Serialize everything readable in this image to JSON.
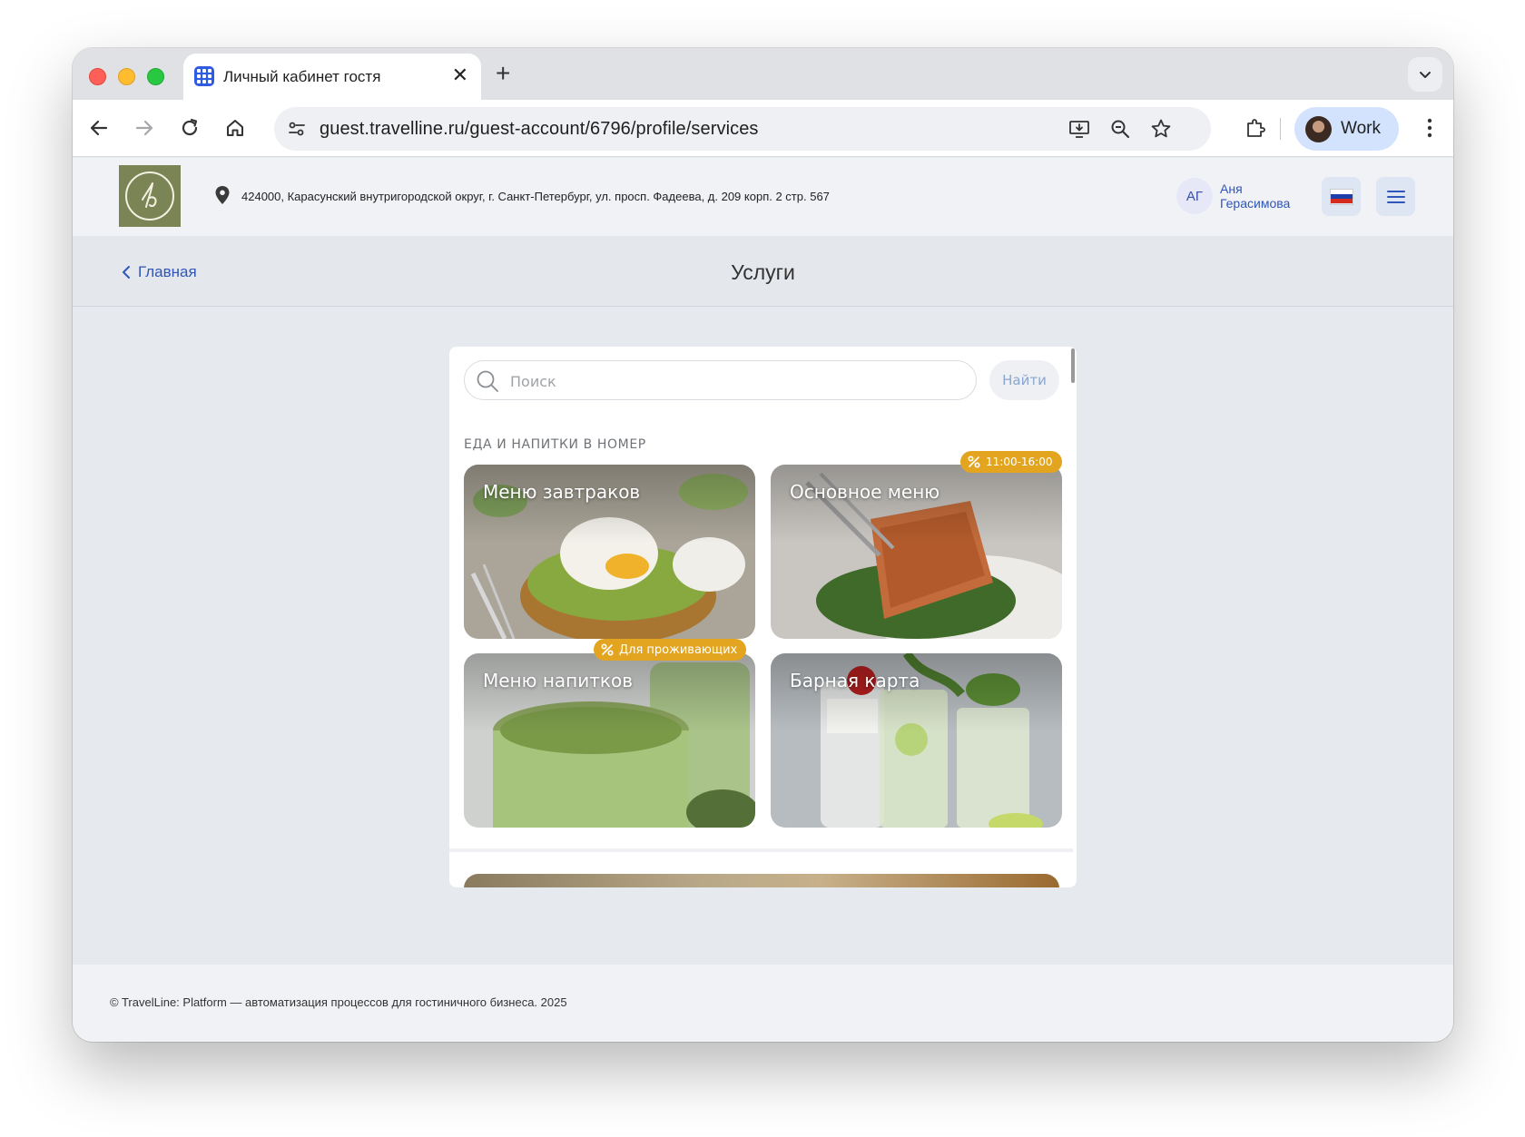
{
  "browser": {
    "tab_title": "Личный кабинет гостя",
    "tab_close": "✕",
    "new_tab": "+",
    "url": "guest.travelline.ru/guest-account/6796/profile/services",
    "profile_label": "Work"
  },
  "header": {
    "address": "424000, Карасунский внутригородской округ, г. Санкт-Петербург, ул. просп. Фадеева, д. 209 корп. 2 стр. 567",
    "user_initials": "АГ",
    "user_name": "Аня Герасимова"
  },
  "page": {
    "back_label": "Главная",
    "title": "Услуги"
  },
  "search": {
    "placeholder": "Поиск",
    "button_label": "Найти"
  },
  "section": {
    "label": "ЕДА И НАПИТКИ В НОМЕР",
    "cards": [
      {
        "title": "Меню завтраков"
      },
      {
        "title": "Основное меню",
        "badge": "11:00-16:00"
      },
      {
        "title": "Меню напитков",
        "badge": "Для проживающих"
      },
      {
        "title": "Барная карта"
      }
    ]
  },
  "footer": {
    "text": "© TravelLine: Platform — автоматизация процессов для гостиничного бизнеса. 2025"
  },
  "colors": {
    "accent_blue": "#2f56b8",
    "badge_orange": "#e3a520",
    "logo_green": "#7b8455"
  }
}
